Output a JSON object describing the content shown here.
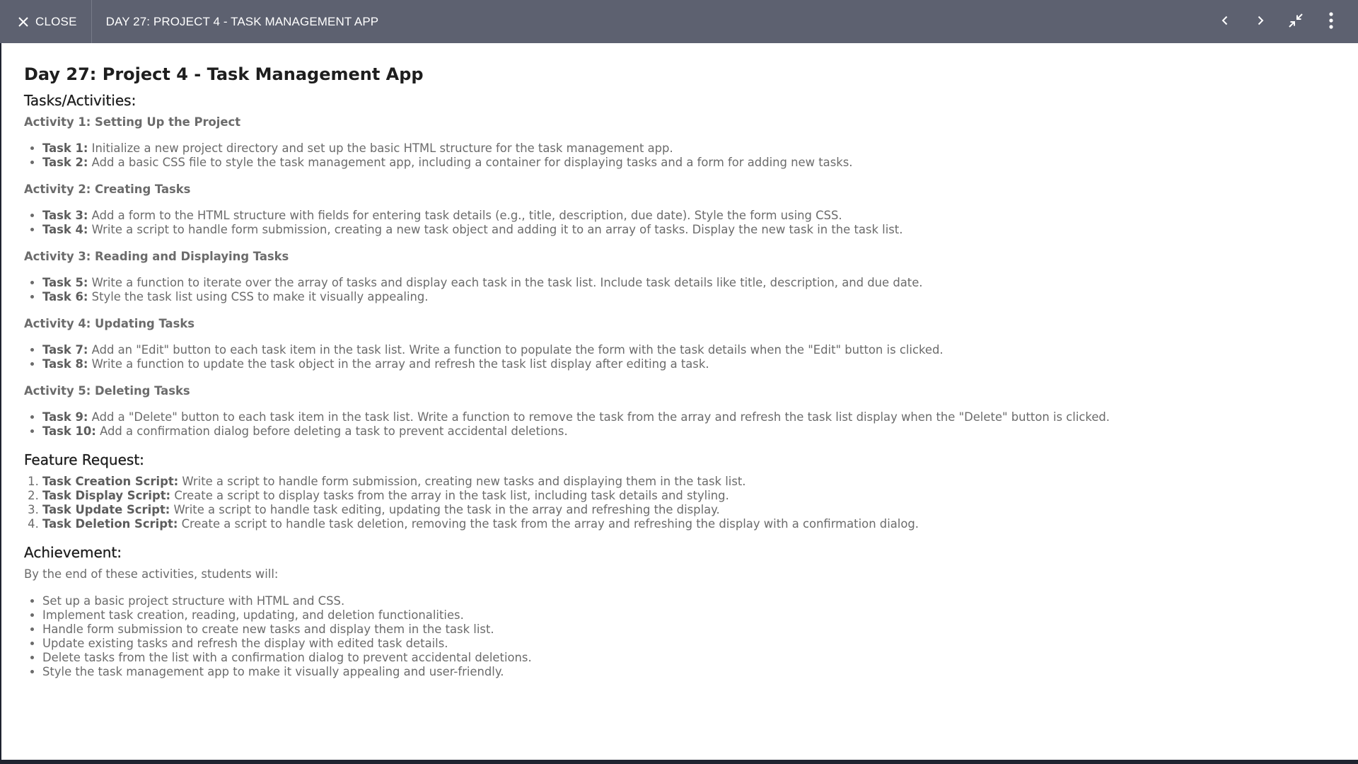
{
  "topbar": {
    "close_label": "CLOSE",
    "title": "DAY 27: PROJECT 4 - TASK MANAGEMENT APP",
    "icons": [
      "close-icon",
      "chevron-left-icon",
      "chevron-right-icon",
      "collapse-icon",
      "more-vert-icon"
    ]
  },
  "doc": {
    "title": "Day 27: Project 4 - Task Management App",
    "tasks_heading": "Tasks/Activities:",
    "activities": [
      {
        "title": "Activity 1: Setting Up the Project",
        "tasks": [
          {
            "label": "Task 1:",
            "text": " Initialize a new project directory and set up the basic HTML structure for the task management app."
          },
          {
            "label": "Task 2:",
            "text": " Add a basic CSS file to style the task management app, including a container for displaying tasks and a form for adding new tasks."
          }
        ]
      },
      {
        "title": "Activity 2: Creating Tasks",
        "tasks": [
          {
            "label": "Task 3:",
            "text": " Add a form to the HTML structure with fields for entering task details (e.g., title, description, due date). Style the form using CSS."
          },
          {
            "label": "Task 4:",
            "text": " Write a script to handle form submission, creating a new task object and adding it to an array of tasks. Display the new task in the task list."
          }
        ]
      },
      {
        "title": "Activity 3: Reading and Displaying Tasks",
        "tasks": [
          {
            "label": "Task 5:",
            "text": " Write a function to iterate over the array of tasks and display each task in the task list. Include task details like title, description, and due date."
          },
          {
            "label": "Task 6:",
            "text": " Style the task list using CSS to make it visually appealing."
          }
        ]
      },
      {
        "title": "Activity 4: Updating Tasks",
        "tasks": [
          {
            "label": "Task 7:",
            "text": " Add an \"Edit\" button to each task item in the task list. Write a function to populate the form with the task details when the \"Edit\" button is clicked."
          },
          {
            "label": "Task 8:",
            "text": " Write a function to update the task object in the array and refresh the task list display after editing a task."
          }
        ]
      },
      {
        "title": "Activity 5: Deleting Tasks",
        "tasks": [
          {
            "label": "Task 9:",
            "text": " Add a \"Delete\" button to each task item in the task list. Write a function to remove the task from the array and refresh the task list display when the \"Delete\" button is clicked."
          },
          {
            "label": "Task 10:",
            "text": " Add a confirmation dialog before deleting a task to prevent accidental deletions."
          }
        ]
      }
    ],
    "feature_heading": "Feature Request:",
    "features": [
      {
        "label": "Task Creation Script:",
        "text": " Write a script to handle form submission, creating new tasks and displaying them in the task list."
      },
      {
        "label": "Task Display Script:",
        "text": " Create a script to display tasks from the array in the task list, including task details and styling."
      },
      {
        "label": "Task Update Script:",
        "text": " Write a script to handle task editing, updating the task in the array and refreshing the display."
      },
      {
        "label": "Task Deletion Script:",
        "text": " Create a script to handle task deletion, removing the task from the array and refreshing the display with a confirmation dialog."
      }
    ],
    "achievement_heading": "Achievement:",
    "achievement_lead": "By the end of these activities, students will:",
    "achievements": [
      "Set up a basic project structure with HTML and CSS.",
      "Implement task creation, reading, updating, and deletion functionalities.",
      "Handle form submission to create new tasks and display them in the task list.",
      "Update existing tasks and refresh the display with edited task details.",
      "Delete tasks from the list with a confirmation dialog to prevent accidental deletions.",
      "Style the task management app to make it visually appealing and user-friendly."
    ]
  }
}
